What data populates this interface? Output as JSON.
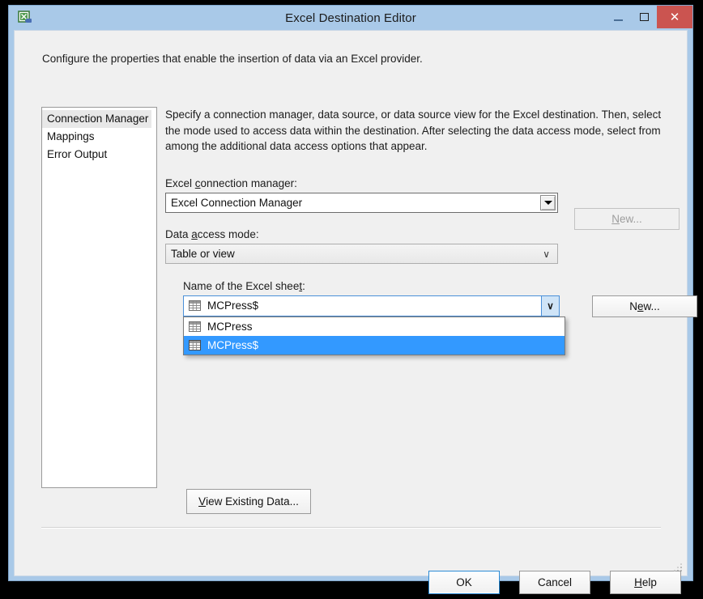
{
  "window": {
    "title": "Excel Destination Editor",
    "icon": "excel-destination-icon",
    "controls": {
      "minimize": "–",
      "maximize": "□",
      "close": "✕"
    }
  },
  "header": {
    "description": "Configure the properties that enable the insertion of data via an Excel provider."
  },
  "sidebar": {
    "items": [
      {
        "label": "Connection Manager",
        "selected": true
      },
      {
        "label": "Mappings",
        "selected": false
      },
      {
        "label": "Error Output",
        "selected": false
      }
    ]
  },
  "main": {
    "description": "Specify a connection manager, data source, or data source view for the Excel destination. Then, select the mode used to access data within the destination. After selecting the data access mode, select from among the additional data access options that appear.",
    "connection_manager": {
      "label_prefix": "Excel ",
      "label_accel": "c",
      "label_suffix": "onnection manager:",
      "value": "Excel Connection Manager",
      "new_button": {
        "prefix": "",
        "accel": "N",
        "suffix": "ew...",
        "enabled": false
      }
    },
    "data_access_mode": {
      "label_prefix": "Data ",
      "label_accel": "a",
      "label_suffix": "ccess mode:",
      "value": "Table or view"
    },
    "excel_sheet": {
      "label_prefix": "Name of the Excel shee",
      "label_accel": "t",
      "label_suffix": ":",
      "value": "MCPress$",
      "dropdown_open": true,
      "options": [
        {
          "label": "MCPress",
          "icon": "table-grid-icon",
          "highlighted": false
        },
        {
          "label": "MCPress$",
          "icon": "table-grid-icon",
          "highlighted": true
        }
      ],
      "new_button": {
        "prefix": "N",
        "accel": "e",
        "suffix": "w...",
        "enabled": true
      }
    },
    "view_existing_data_button": {
      "prefix": "",
      "accel": "V",
      "suffix": "iew Existing Data..."
    }
  },
  "footer": {
    "buttons": [
      {
        "prefix": "OK",
        "accel": "",
        "suffix": "",
        "default": true
      },
      {
        "prefix": "Cancel",
        "accel": "",
        "suffix": "",
        "default": false
      },
      {
        "prefix": "",
        "accel": "H",
        "suffix": "elp",
        "default": false
      }
    ]
  },
  "colors": {
    "titlebar": "#a9c9e8",
    "dialog_bg": "#f0f0f0",
    "close_button": "#cb5450",
    "highlight": "#3399ff",
    "focus_border": "#2a8ad4"
  }
}
